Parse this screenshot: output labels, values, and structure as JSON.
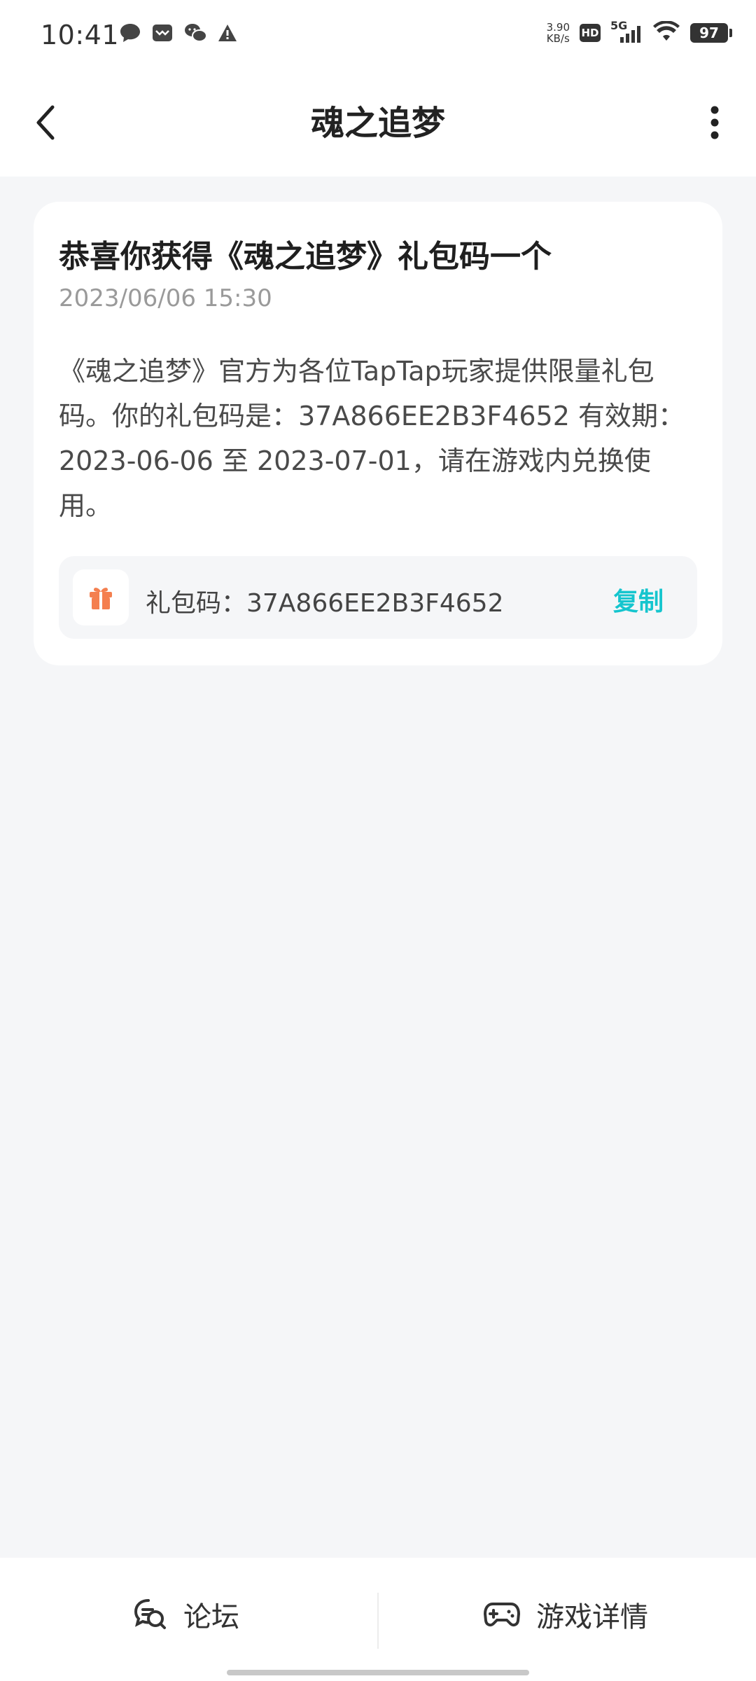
{
  "status_bar": {
    "time": "10:41",
    "net_speed_value": "3.90",
    "net_speed_unit": "KB/s",
    "hd_label": "HD",
    "signal_label": "5G",
    "battery": "97"
  },
  "header": {
    "title": "魂之追梦"
  },
  "message": {
    "title": "恭喜你获得《魂之追梦》礼包码一个",
    "time": "2023/06/06 15:30",
    "body": "《魂之追梦》官方为各位TapTap玩家提供限量礼包码。你的礼包码是：37A866EE2B3F4652 有效期：2023-06-06 至 2023-07-01，请在游戏内兑换使用。",
    "code_label": "礼包码：37A866EE2B3F4652",
    "copy_label": "复制"
  },
  "bottom_nav": {
    "forum_label": "论坛",
    "game_detail_label": "游戏详情"
  },
  "colors": {
    "accent": "#15c5ce",
    "gift_icon": "#f47f4f",
    "background": "#f5f6f8"
  }
}
